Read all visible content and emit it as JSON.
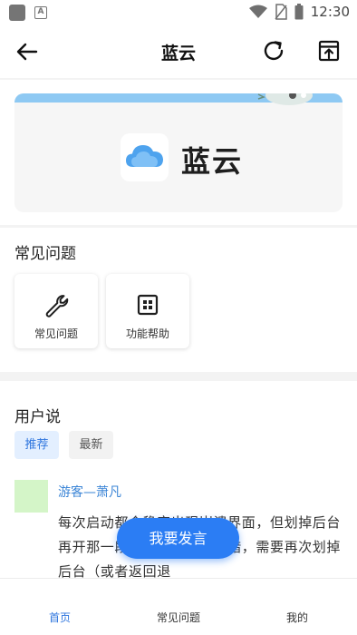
{
  "status_bar": {
    "time": "12:30"
  },
  "app_bar": {
    "title": "蓝云"
  },
  "banner": {
    "app_name": "蓝云"
  },
  "faq_section": {
    "title": "常见问题",
    "tiles": [
      {
        "label": "常见问题",
        "icon": "wrench-icon"
      },
      {
        "label": "功能帮助",
        "icon": "grid-box-icon"
      }
    ]
  },
  "user_section": {
    "title": "用户说",
    "tabs": [
      {
        "label": "推荐",
        "active": true
      },
      {
        "label": "最新",
        "active": false
      }
    ],
    "post": {
      "username": "游客—萧凡",
      "text": "每次启动都会稳定出现崩溃界面，但划掉后台再开那一段时间再开又会报错，需要再次划掉后台（或者返回退"
    }
  },
  "fab": {
    "label": "我要发言"
  },
  "bottom_nav": [
    {
      "label": "首页",
      "active": true
    },
    {
      "label": "常见问题",
      "active": false
    },
    {
      "label": "我的",
      "active": false
    }
  ],
  "colors": {
    "accent": "#2b7df4",
    "active_tab_text": "#2f76de",
    "banner_strip": "#8ec9f3"
  }
}
